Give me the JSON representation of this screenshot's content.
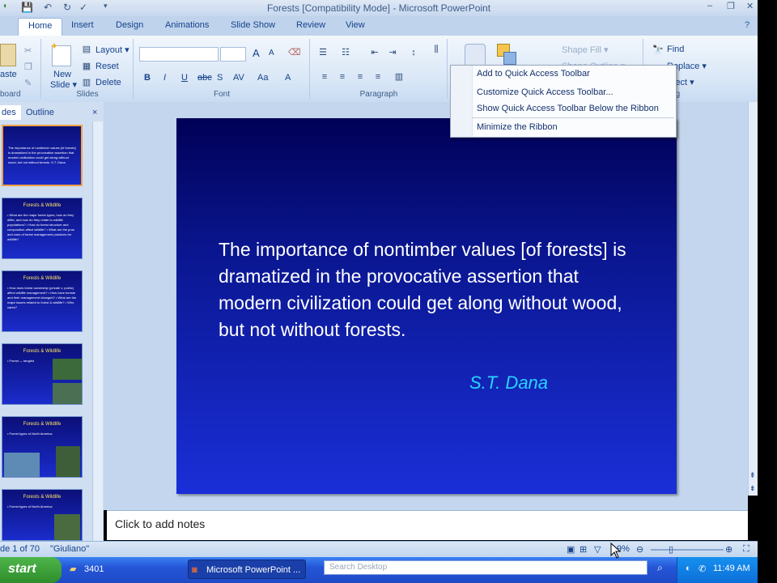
{
  "window": {
    "title": "Forests [Compatibility Mode] - Microsoft PowerPoint",
    "minimize": "–",
    "restore": "❐",
    "close": "✕"
  },
  "qat": {
    "save": "💾",
    "undo": "↶",
    "redo": "↻",
    "spell": "✓",
    "more": "▾"
  },
  "tabs": [
    "Home",
    "Insert",
    "Design",
    "Animations",
    "Slide Show",
    "Review",
    "View"
  ],
  "ribbon": {
    "clipboard": {
      "label": "board",
      "paste": "aste"
    },
    "slides": {
      "label": "Slides",
      "new_slide": "New",
      "new_slide2": "Slide ▾",
      "layout": "Layout ▾",
      "reset": "Reset",
      "delete": "Delete"
    },
    "font": {
      "label": "Font",
      "bold": "B",
      "italic": "I",
      "underline": "U",
      "strike": "abc",
      "spacing": "AV",
      "case": "Aa",
      "color": "A",
      "grow": "A",
      "shrink": "A"
    },
    "paragraph": {
      "label": "Paragraph"
    },
    "drawing": {
      "shape_fill": "Shape Fill ▾",
      "shape_outline": "Shape Outline ▾"
    },
    "editing": {
      "label": "iting",
      "find": "Find",
      "replace": "Replace ▾",
      "select": "lect ▾"
    }
  },
  "context_menu": {
    "items": [
      "Add to Quick Access Toolbar",
      "Customize Quick Access Toolbar...",
      "Show Quick Access Toolbar Below the Ribbon",
      "Minimize the Ribbon"
    ]
  },
  "left_panel": {
    "tab_slides": "des",
    "tab_outline": "Outline",
    "close": "×",
    "thumbnails": [
      {
        "title": "",
        "body": "The importance of nontimber values [of forests] is dramatized in the provocative assertion that modern civilization could get along without wood, but not without forests. S.T. Dana"
      },
      {
        "title": "Forests & Wildlife",
        "body": "• What are the major forest types, how do they differ, and how do they relate to wildlife populations? • How do forest structure and composition affect wildlife? • What are the pros and cons of forest management practices for wildlife?"
      },
      {
        "title": "Forests & Wildlife",
        "body": "• How does forest ownership (private v. public) affect wildlife management? • How have forests and their management changed? • What are the major issues related to forest & wildlife? • Who cares?"
      },
      {
        "title": "Forests & Wildlife",
        "body": "• Forest — tangled"
      },
      {
        "title": "Forests & Wildlife",
        "body": "• Forest types of North America"
      },
      {
        "title": "Forests & Wildlife",
        "body": "• Forest types of North America"
      }
    ]
  },
  "slide": {
    "quote": "The importance of nontimber values [of forests] is dramatized in the provocative assertion that modern civilization could get along without wood, but not without forests.",
    "author": "S.T. Dana"
  },
  "notes": {
    "placeholder": "Click to add notes"
  },
  "status": {
    "slide_count": "de 1 of 70",
    "theme": "\"Giuliano\"",
    "zoom": "9%"
  },
  "taskbar": {
    "start": "start",
    "folder": "3401",
    "powerpoint": "Microsoft PowerPoint ...",
    "search_placeholder": "Search Desktop",
    "clock": "11:49 AM"
  },
  "colors": {
    "slide_bg": "#1a2fd8",
    "quote_text": "#ffffff",
    "author_text": "#29d4ff",
    "thumb_title": "#ffe566",
    "taskbar": "#2455d6",
    "start_button": "#3a9b36"
  }
}
